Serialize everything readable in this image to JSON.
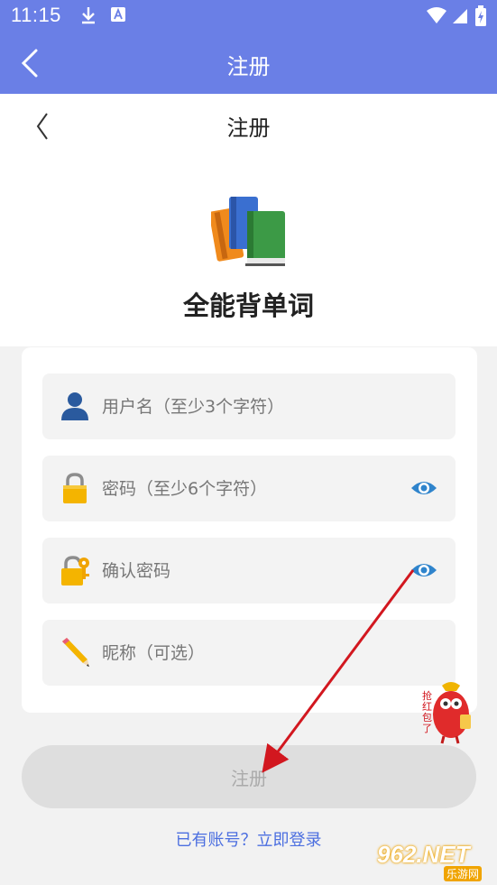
{
  "status_bar": {
    "time": "11:15",
    "icons": [
      "download-icon",
      "font-icon",
      "wifi-icon",
      "signal-icon",
      "battery-icon"
    ]
  },
  "app_bar": {
    "title": "注册"
  },
  "page": {
    "title": "注册",
    "app_name": "全能背单词"
  },
  "form": {
    "username_placeholder": "用户名（至少3个字符）",
    "password_placeholder": "密码（至少6个字符）",
    "confirm_placeholder": "确认密码",
    "nickname_placeholder": "昵称（可选）",
    "submit_label": "注册",
    "login_link": "已有账号？立即登录"
  },
  "overlay": {
    "badge_text": "抢红包了",
    "watermark": "962.NET",
    "watermark_sub": "乐游网"
  },
  "colors": {
    "primary": "#6a7fe6",
    "link": "#4c6fe0",
    "eye": "#2f84cc",
    "arrow": "#d2171f"
  }
}
